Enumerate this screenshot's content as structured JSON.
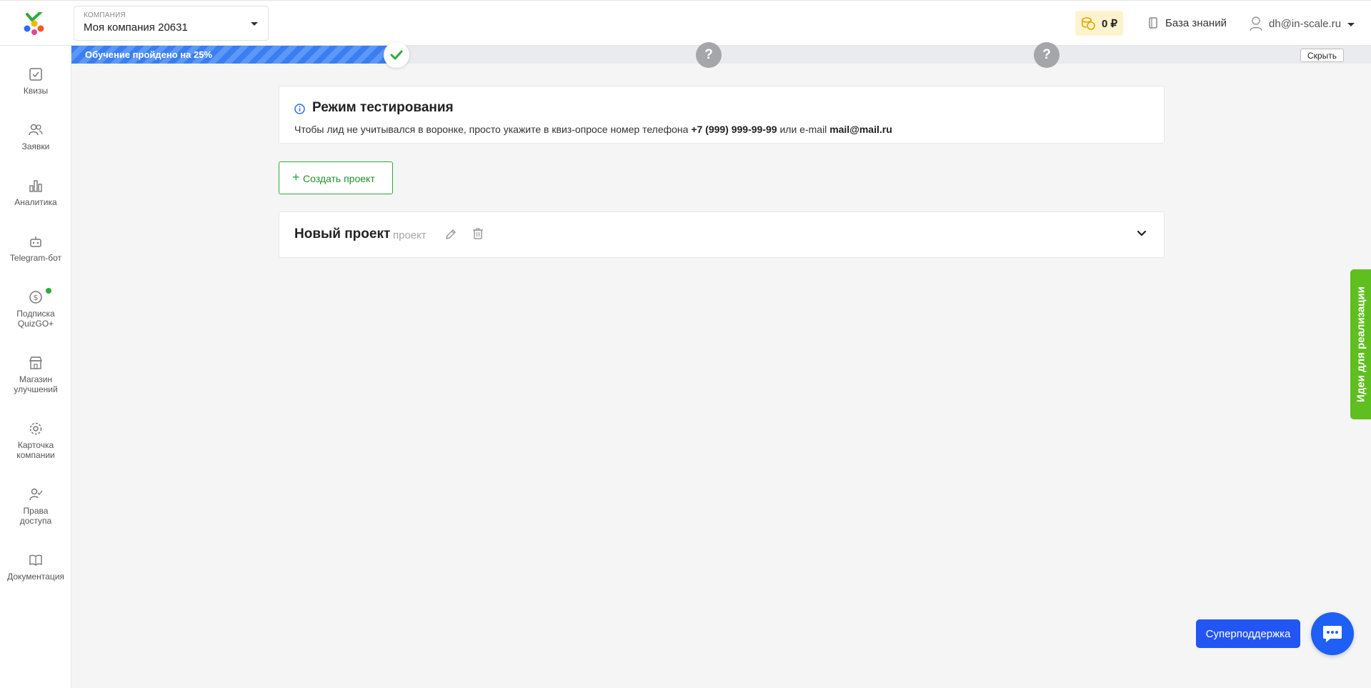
{
  "header": {
    "company_label": "КОМПАНИЯ",
    "company_name": "Моя компания 20631",
    "balance": "0 ₽",
    "knowledge_base": "База знаний",
    "user_email": "dh@in-scale.ru"
  },
  "sidebar": {
    "items": [
      {
        "label": "Квизы",
        "icon": "checkbox-icon"
      },
      {
        "label": "Заявки",
        "icon": "users-icon"
      },
      {
        "label": "Аналитика",
        "icon": "bar-chart-icon"
      },
      {
        "label": "Telegram-бот",
        "icon": "robot-icon"
      },
      {
        "label": "Подписка QuizGO+",
        "icon": "dollar-coin-icon"
      },
      {
        "label": "Магазин улучшений",
        "icon": "store-icon"
      },
      {
        "label": "Карточка компании",
        "icon": "gear-icon"
      },
      {
        "label": "Права доступа",
        "icon": "user-check-icon"
      },
      {
        "label": "Документация",
        "icon": "book-icon"
      }
    ]
  },
  "onboarding": {
    "progress_text": "Обучение пройдено на 25%",
    "progress_percent": 25,
    "hide_label": "Скрыть",
    "milestones": [
      {
        "state": "done",
        "symbol": "✓"
      },
      {
        "state": "todo",
        "symbol": "?"
      },
      {
        "state": "todo",
        "symbol": "?"
      }
    ]
  },
  "test_mode": {
    "title": "Режим тестирования",
    "text_before": "Чтобы лид не учитывался в воронке, просто укажите в квиз-опросе номер телефона ",
    "phone": "+7 (999) 999-99-99",
    "text_middle": " или e-mail ",
    "email": "mail@mail.ru"
  },
  "create_button": {
    "plus": "+",
    "label": "Создать проект"
  },
  "project": {
    "title": "Новый проект",
    "type": "проект"
  },
  "ideas_tab": {
    "label": "Идеи для реализации"
  },
  "support": {
    "label": "Суперподдержка"
  },
  "colors": {
    "accent_green": "#2eaa3d",
    "progress_blue": "#3a7ef0",
    "support_blue": "#2355f5",
    "ideas_green": "#5fbf1f",
    "balance_bg": "#fff3cd"
  }
}
